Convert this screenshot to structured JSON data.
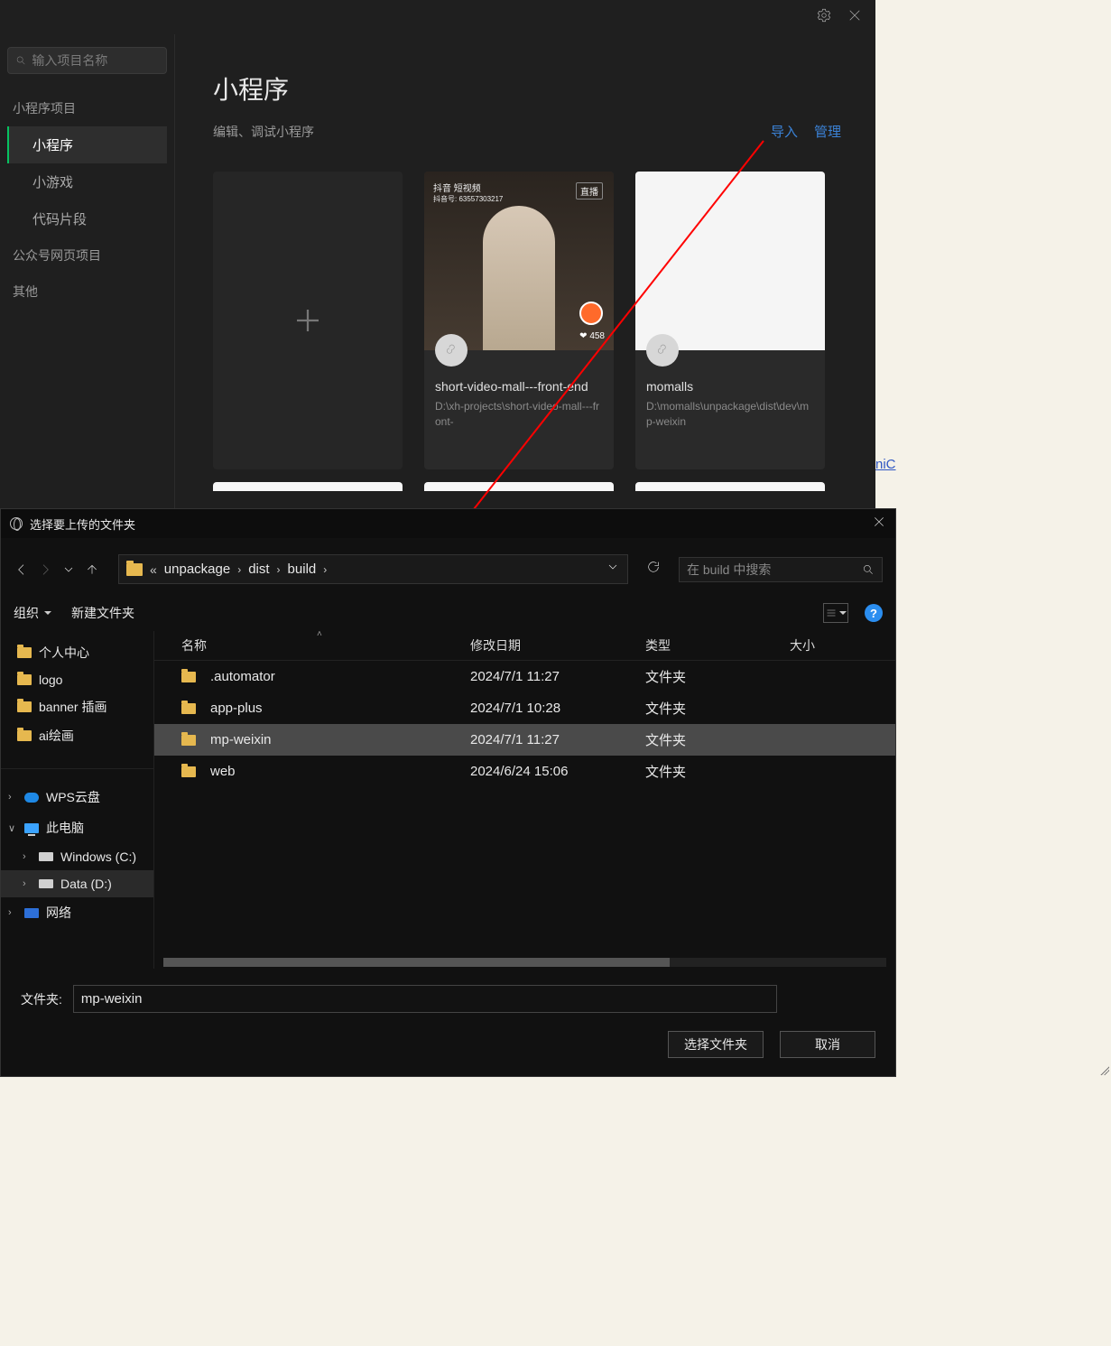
{
  "devtools": {
    "search_placeholder": "输入项目名称",
    "nav": {
      "group_mini": "小程序项目",
      "item_miniapp": "小程序",
      "item_minigame": "小游戏",
      "item_snippet": "代码片段",
      "group_oa": "公众号网页项目",
      "group_other": "其他"
    },
    "main": {
      "title": "小程序",
      "subtitle": "编辑、调试小程序",
      "link_import": "导入",
      "link_manage": "管理"
    },
    "cards": [
      {
        "name": "short-video-mall---front-end",
        "path": "D:\\xh-projects\\short-video-mall---front-",
        "douyin_top": "抖音 短视频",
        "douyin_id": "抖音号: 63557303217",
        "live_label": "直播",
        "like_count": "458"
      },
      {
        "name": "momalls",
        "path": "D:\\momalls\\unpackage\\dist\\dev\\mp-weixin"
      }
    ]
  },
  "right_link_fragment": "niC",
  "filedlg": {
    "title": "选择要上传的文件夹",
    "breadcrumbs": [
      "unpackage",
      "dist",
      "build"
    ],
    "search_placeholder": "在 build 中搜索",
    "organize": "组织",
    "new_folder": "新建文件夹",
    "columns": {
      "name": "名称",
      "date": "修改日期",
      "type": "类型",
      "size": "大小"
    },
    "quick": [
      {
        "label": "个人中心"
      },
      {
        "label": "logo"
      },
      {
        "label": "banner 插画"
      },
      {
        "label": "ai绘画"
      }
    ],
    "drives": [
      {
        "label": "WPS云盘",
        "icon": "cloud",
        "chev": ">"
      },
      {
        "label": "此电脑",
        "icon": "pc",
        "chev": "∨"
      },
      {
        "label": "Windows (C:)",
        "icon": "disk",
        "chev": ">",
        "indent": true
      },
      {
        "label": "Data (D:)",
        "icon": "disk",
        "chev": ">",
        "indent": true,
        "sel": true
      },
      {
        "label": "网络",
        "icon": "net",
        "chev": ">"
      }
    ],
    "rows": [
      {
        "name": ".automator",
        "date": "2024/7/1 11:27",
        "type": "文件夹"
      },
      {
        "name": "app-plus",
        "date": "2024/7/1 10:28",
        "type": "文件夹"
      },
      {
        "name": "mp-weixin",
        "date": "2024/7/1 11:27",
        "type": "文件夹",
        "sel": true
      },
      {
        "name": "web",
        "date": "2024/6/24 15:06",
        "type": "文件夹"
      }
    ],
    "folder_label": "文件夹:",
    "folder_value": "mp-weixin",
    "btn_select": "选择文件夹",
    "btn_cancel": "取消"
  }
}
